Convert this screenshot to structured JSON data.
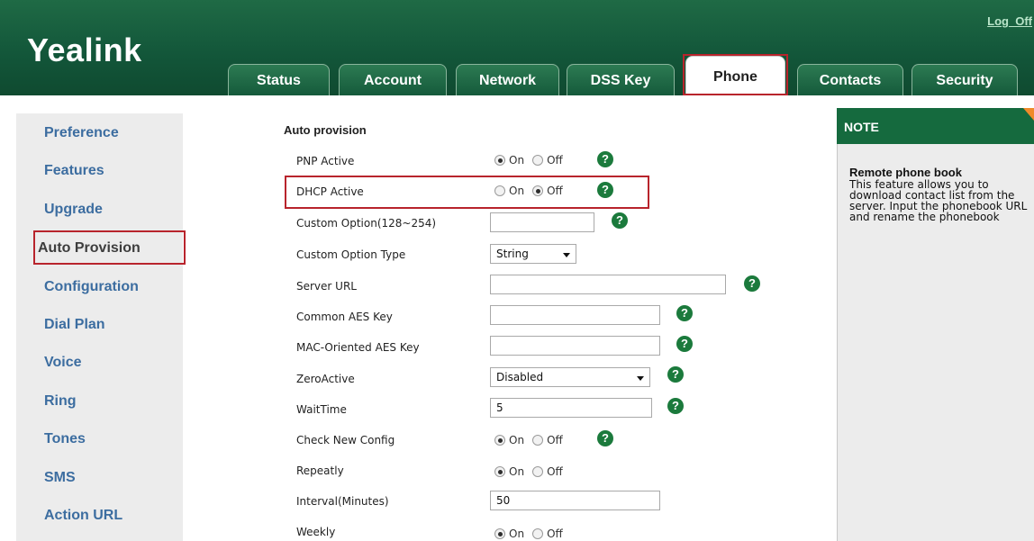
{
  "brand": {
    "logo": "Yealink",
    "logout": "Log_Off"
  },
  "tabs": [
    {
      "label": "Status",
      "active": false
    },
    {
      "label": "Account",
      "active": false
    },
    {
      "label": "Network",
      "active": false
    },
    {
      "label": "DSS Key",
      "active": false
    },
    {
      "label": "Phone",
      "active": true
    },
    {
      "label": "Contacts",
      "active": false
    },
    {
      "label": "Security",
      "active": false
    }
  ],
  "sidebar": {
    "items": [
      {
        "label": "Preference"
      },
      {
        "label": "Features"
      },
      {
        "label": "Upgrade"
      },
      {
        "label": "Auto Provision",
        "active": true
      },
      {
        "label": "Configuration"
      },
      {
        "label": "Dial Plan"
      },
      {
        "label": "Voice"
      },
      {
        "label": "Ring"
      },
      {
        "label": "Tones"
      },
      {
        "label": "SMS"
      },
      {
        "label": "Action URL"
      }
    ]
  },
  "form": {
    "section_title": "Auto provision",
    "radio_on": "On",
    "radio_off": "Off",
    "help_glyph": "?",
    "pnp_active": {
      "label": "PNP Active",
      "value": "On"
    },
    "dhcp_active": {
      "label": "DHCP Active",
      "value": "Off"
    },
    "custom_option": {
      "label": "Custom Option(128~254)",
      "value": ""
    },
    "custom_option_type": {
      "label": "Custom Option Type",
      "value": "String"
    },
    "server_url": {
      "label": "Server URL",
      "value": ""
    },
    "common_aes_key": {
      "label": "Common AES Key",
      "value": ""
    },
    "mac_aes_key": {
      "label": "MAC-Oriented AES Key",
      "value": ""
    },
    "zero_active": {
      "label": "ZeroActive",
      "value": "Disabled"
    },
    "wait_time": {
      "label": "WaitTime",
      "value": "5"
    },
    "check_new_config": {
      "label": "Check New Config",
      "value": "On"
    },
    "repeatly": {
      "label": "Repeatly",
      "value": "On"
    },
    "interval": {
      "label": "Interval(Minutes)",
      "value": "50"
    },
    "weekly": {
      "label": "Weekly",
      "value": "On"
    }
  },
  "note": {
    "header": "NOTE",
    "title": "Remote phone book",
    "body": "This feature allows you to download contact list from the server. Input the phonebook URL and rename the phonebook"
  },
  "colors": {
    "header_green": "#13573a",
    "nav_link": "#3c6da0",
    "highlight_red": "#b8242c",
    "help_green": "#1b7a3c",
    "note_corner": "#f08a2a"
  }
}
